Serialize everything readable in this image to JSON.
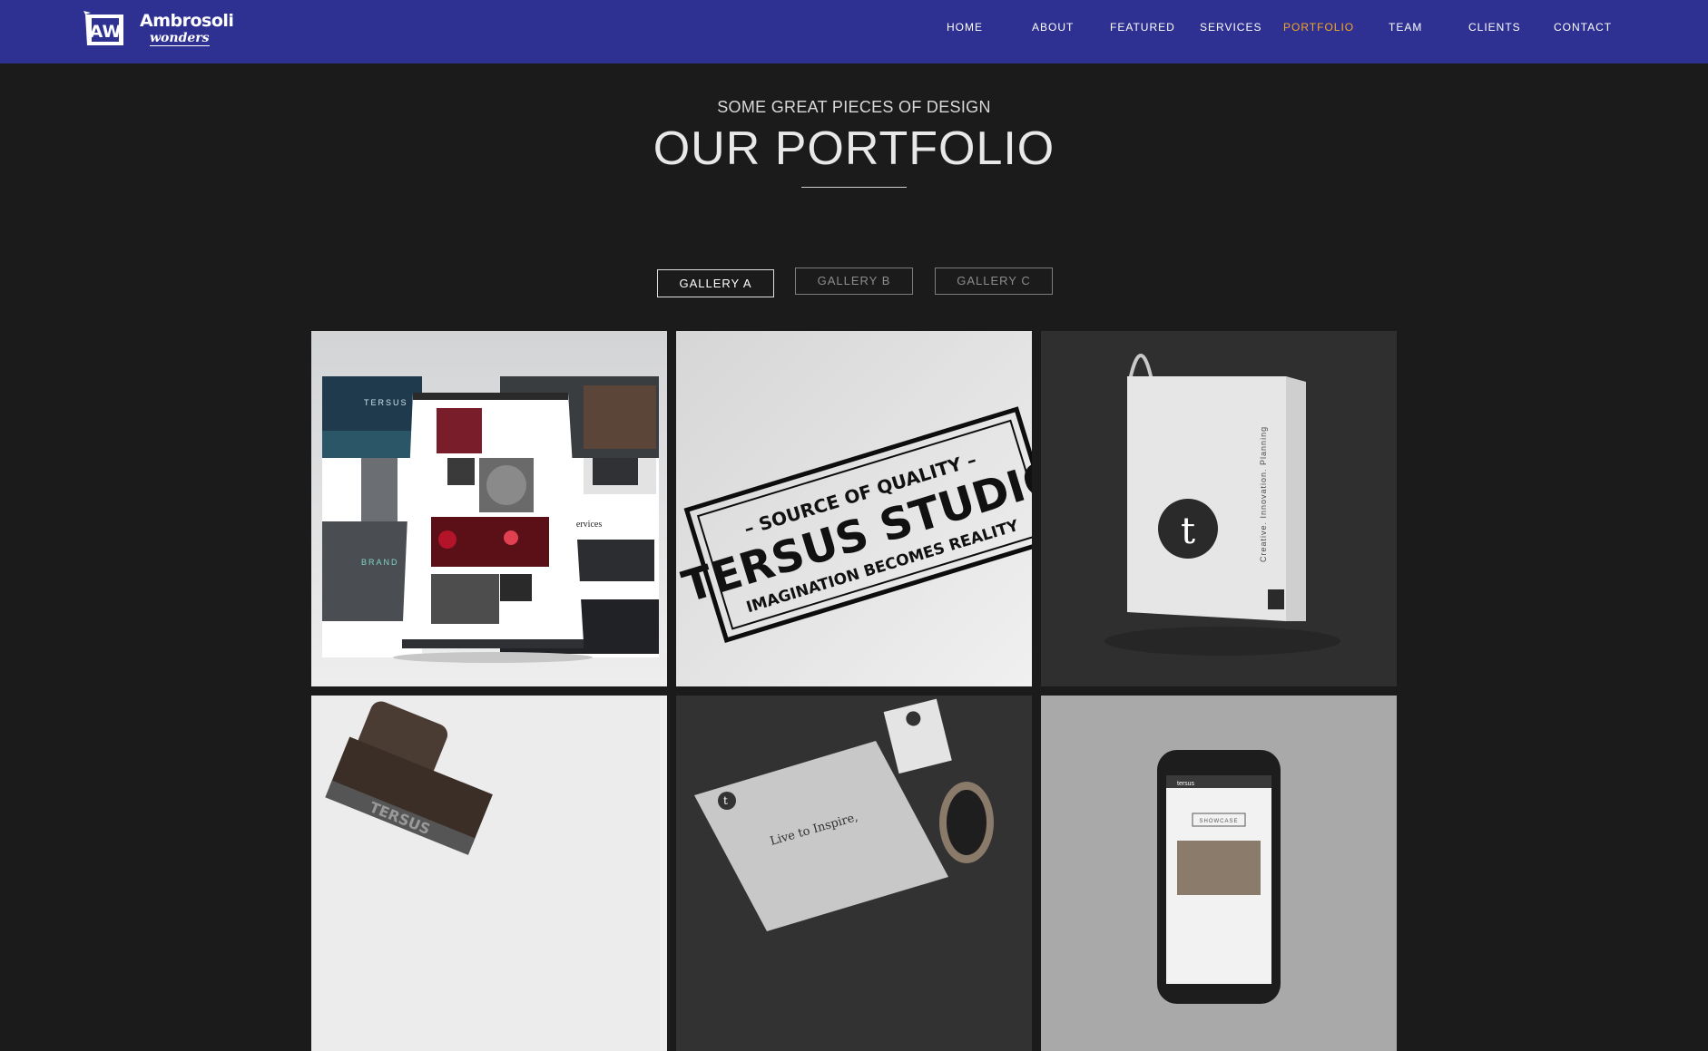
{
  "brand": {
    "logo_text": "AW",
    "name": "Ambrosoli",
    "tagline": "wonders"
  },
  "nav": {
    "items": [
      {
        "label": "HOME"
      },
      {
        "label": "ABOUT"
      },
      {
        "label": "FEATURED"
      },
      {
        "label": "SERVICES"
      },
      {
        "label": "PORTFOLIO",
        "active": true
      },
      {
        "label": "TEAM"
      },
      {
        "label": "CLIENTS"
      },
      {
        "label": "CONTACT"
      }
    ],
    "bg_color": "#2e3192",
    "active_color": "#f5a623"
  },
  "portfolio": {
    "subtitle": "SOME GREAT PIECES OF DESIGN",
    "title": "OUR PORTFOLIO",
    "filters": [
      {
        "label": "GALLERY A",
        "active": true
      },
      {
        "label": "GALLERY B"
      },
      {
        "label": "GALLERY C"
      }
    ],
    "items": [
      {
        "name": "website-mockup",
        "hero_text": "TERSUS",
        "brand_text": "BRAND",
        "services_text": "services"
      },
      {
        "name": "tersus-studio-stamp-print",
        "line1": "– SOURCE OF QUALITY –",
        "line2": "TERSUS STUDIO",
        "line3": "IMAGINATION BECOMES REALITY"
      },
      {
        "name": "shopping-bag",
        "logo_letter": "t",
        "side_text": "Creative. Innovation. Planning"
      },
      {
        "name": "rubber-stamp",
        "stamp_text": "TERSUS"
      },
      {
        "name": "letterhead-stationery",
        "logo_letter": "t",
        "letter_text": "Live to Inspire,"
      },
      {
        "name": "phone-mockup",
        "app_name": "tersus",
        "button_text": "SHOWCASE"
      }
    ]
  }
}
